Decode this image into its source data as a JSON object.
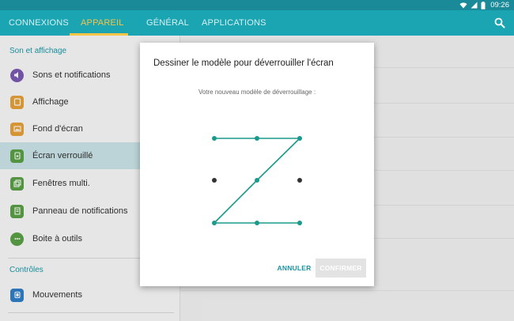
{
  "status_bar": {
    "time": "09:26",
    "icons": [
      "wifi-icon",
      "signal-icon",
      "battery-icon"
    ]
  },
  "tabs": [
    {
      "label": "CONNEXIONS",
      "active": false
    },
    {
      "label": "APPAREIL",
      "active": true
    },
    {
      "label": "GÉNÉRAL",
      "active": false
    },
    {
      "label": "APPLICATIONS",
      "active": false
    }
  ],
  "sidebar": {
    "section1": "Son et affichage",
    "section2": "Contrôles",
    "items": [
      {
        "label": "Sons et notifications",
        "icon": "speaker-icon",
        "color": "#7b5bb5"
      },
      {
        "label": "Affichage",
        "icon": "display-icon",
        "color": "#e8a23a"
      },
      {
        "label": "Fond d'écran",
        "icon": "wallpaper-icon",
        "color": "#e8a23a"
      },
      {
        "label": "Écran verrouillé",
        "icon": "lock-screen-icon",
        "color": "#5aa145",
        "selected": true
      },
      {
        "label": "Fenêtres multi.",
        "icon": "multi-window-icon",
        "color": "#5aa145"
      },
      {
        "label": "Panneau de notifications",
        "icon": "notification-panel-icon",
        "color": "#5aa145"
      },
      {
        "label": "Boite à outils",
        "icon": "toolbox-icon",
        "color": "#5aa145"
      },
      {
        "label": "Mouvements",
        "icon": "motion-icon",
        "color": "#2f7fc8"
      }
    ]
  },
  "dialog": {
    "title": "Dessiner le modèle pour déverrouiller l'écran",
    "subtitle": "Votre nouveau modèle de déverrouillage :",
    "cancel_label": "ANNULER",
    "confirm_label": "CONFIRMER",
    "pattern_sequence": [
      1,
      2,
      3,
      5,
      7,
      8,
      9
    ],
    "accent_color": "#1a9a8a",
    "inactive_dot_color": "#333333"
  },
  "colors": {
    "tab_bar": "#1ba5b3",
    "status_bar": "#1a8a99",
    "active_tab": "#f6c445",
    "accent_text": "#1a95a3"
  }
}
